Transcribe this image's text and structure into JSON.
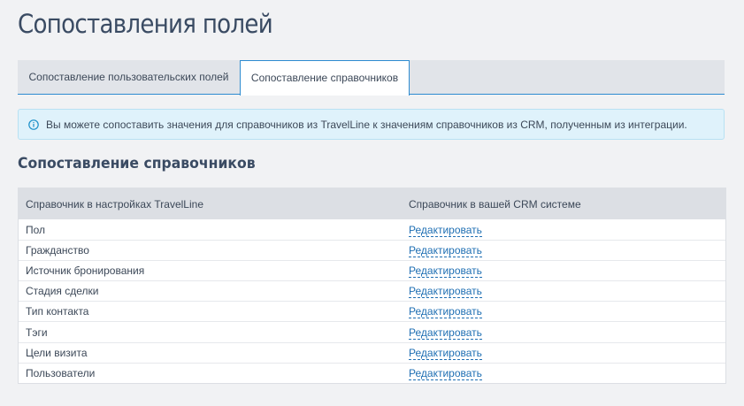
{
  "page": {
    "title": "Сопоставления полей"
  },
  "tabs": [
    {
      "label": "Сопоставление пользовательских полей",
      "active": false
    },
    {
      "label": "Сопоставление справочников",
      "active": true
    }
  ],
  "info": {
    "icon": "info-circle-icon",
    "text": "Вы можете сопоставить значения для справочников из TravelLine к значениям справочников из CRM, полученным из интеграции."
  },
  "section": {
    "title": "Сопоставление справочников"
  },
  "table": {
    "headers": [
      "Справочник в настройках TravelLine",
      "Справочник в вашей CRM системе"
    ],
    "rows": [
      {
        "name": "Пол",
        "action": "Редактировать"
      },
      {
        "name": "Гражданство",
        "action": "Редактировать"
      },
      {
        "name": "Источник бронирования",
        "action": "Редактировать"
      },
      {
        "name": "Стадия сделки",
        "action": "Редактировать"
      },
      {
        "name": "Тип контакта",
        "action": "Редактировать"
      },
      {
        "name": "Тэги",
        "action": "Редактировать"
      },
      {
        "name": "Цели визита",
        "action": "Редактировать"
      },
      {
        "name": "Пользователи",
        "action": "Редактировать"
      }
    ]
  },
  "colors": {
    "accent": "#2d8bd0",
    "link": "#1f6fb3",
    "info_bg": "#dff2fb",
    "page_bg": "#f1f2f4"
  }
}
